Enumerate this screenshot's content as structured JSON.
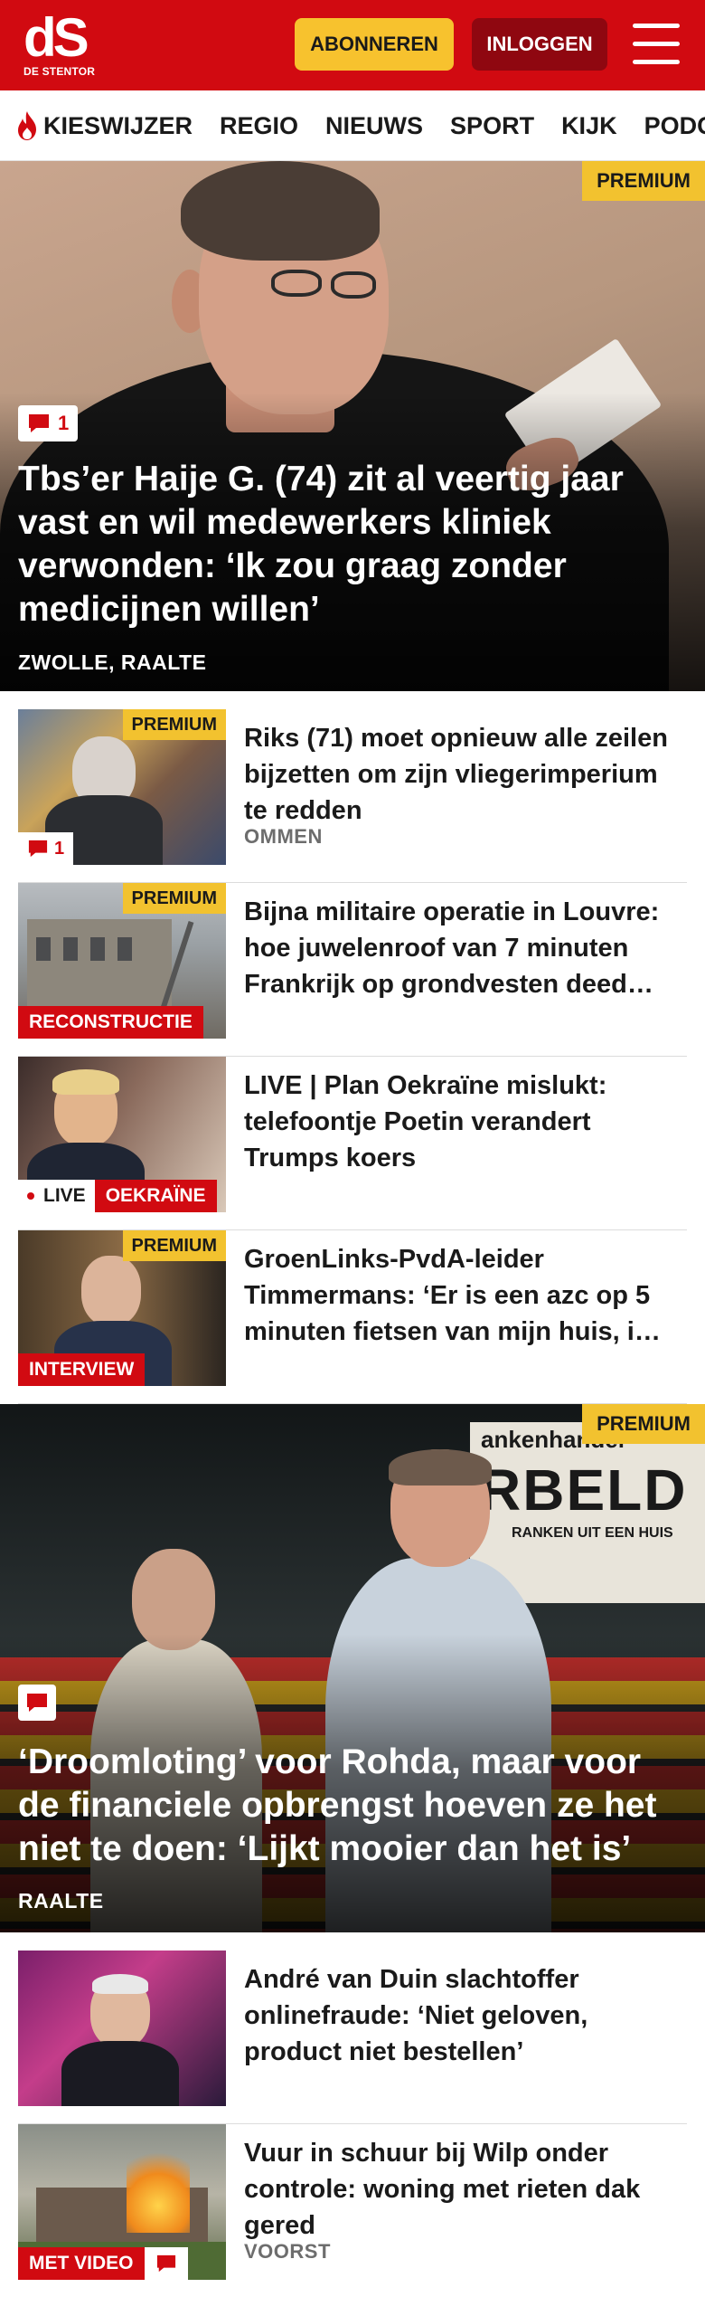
{
  "header": {
    "logo_mark": "dS",
    "logo_sub": "DE STENTOR",
    "subscribe_label": "ABONNEREN",
    "login_label": "INLOGGEN",
    "brand_red": "#d10a11",
    "accent_yellow": "#f2c22f"
  },
  "nav": {
    "items": [
      {
        "label": "KIESWIJZER",
        "icon": "flame-icon"
      },
      {
        "label": "REGIO"
      },
      {
        "label": "NIEUWS"
      },
      {
        "label": "SPORT"
      },
      {
        "label": "KIJK"
      },
      {
        "label": "PODCAST"
      }
    ]
  },
  "hero1": {
    "premium": "PREMIUM",
    "comments": "1",
    "title": "Tbs’er Haije G. (74) zit al veertig jaar vast en wil medewerkers kliniek verwonden: ‘Ik zou graag zonder medicijnen willen’",
    "location": "ZWOLLE, RAALTE"
  },
  "list1": [
    {
      "premium": "PREMIUM",
      "comments": "1",
      "title": "Riks (71) moet opnieuw alle zeilen bijzetten om zijn vliegerimperi­um te redden",
      "location": "OMMEN"
    },
    {
      "premium": "PREMIUM",
      "label": "RECONSTRUCTIE",
      "title": "Bijna militaire operatie in Louvre: hoe juwelenroof van 7 minuten Frankrijk op grondvesten deed…"
    },
    {
      "live": "LIVE",
      "label": "OEKRAÏNE",
      "title": "LIVE | Plan Oekraïne mislukt: telefoontje Poetin verandert Trumps koers"
    },
    {
      "premium": "PREMIUM",
      "label": "INTERVIEW",
      "title": "GroenLinks-PvdA-leider Timmermans: ‘Er is een azc op 5 minuten fietsen van mijn huis, i…"
    }
  ],
  "hero2": {
    "premium": "PREMIUM",
    "sign_line1": "ankenhandel",
    "sign_line2": "RBELD",
    "sign_line3": "RANKEN UIT EEN HUIS",
    "title": "‘Droomloting’ voor Rohda, maar voor de financiele opbrengst hoeven ze het niet te doen: ‘Lijkt mooier dan het is’",
    "location": "RAALTE"
  },
  "list2": [
    {
      "title": "André van Duin slachtoffer onlinefraude: ‘Niet geloven, product niet bestellen’"
    },
    {
      "label": "MET VIDEO",
      "title": "Vuur in schuur bij Wilp onder controle: woning met rieten dak gered",
      "location": "VOORST"
    }
  ]
}
